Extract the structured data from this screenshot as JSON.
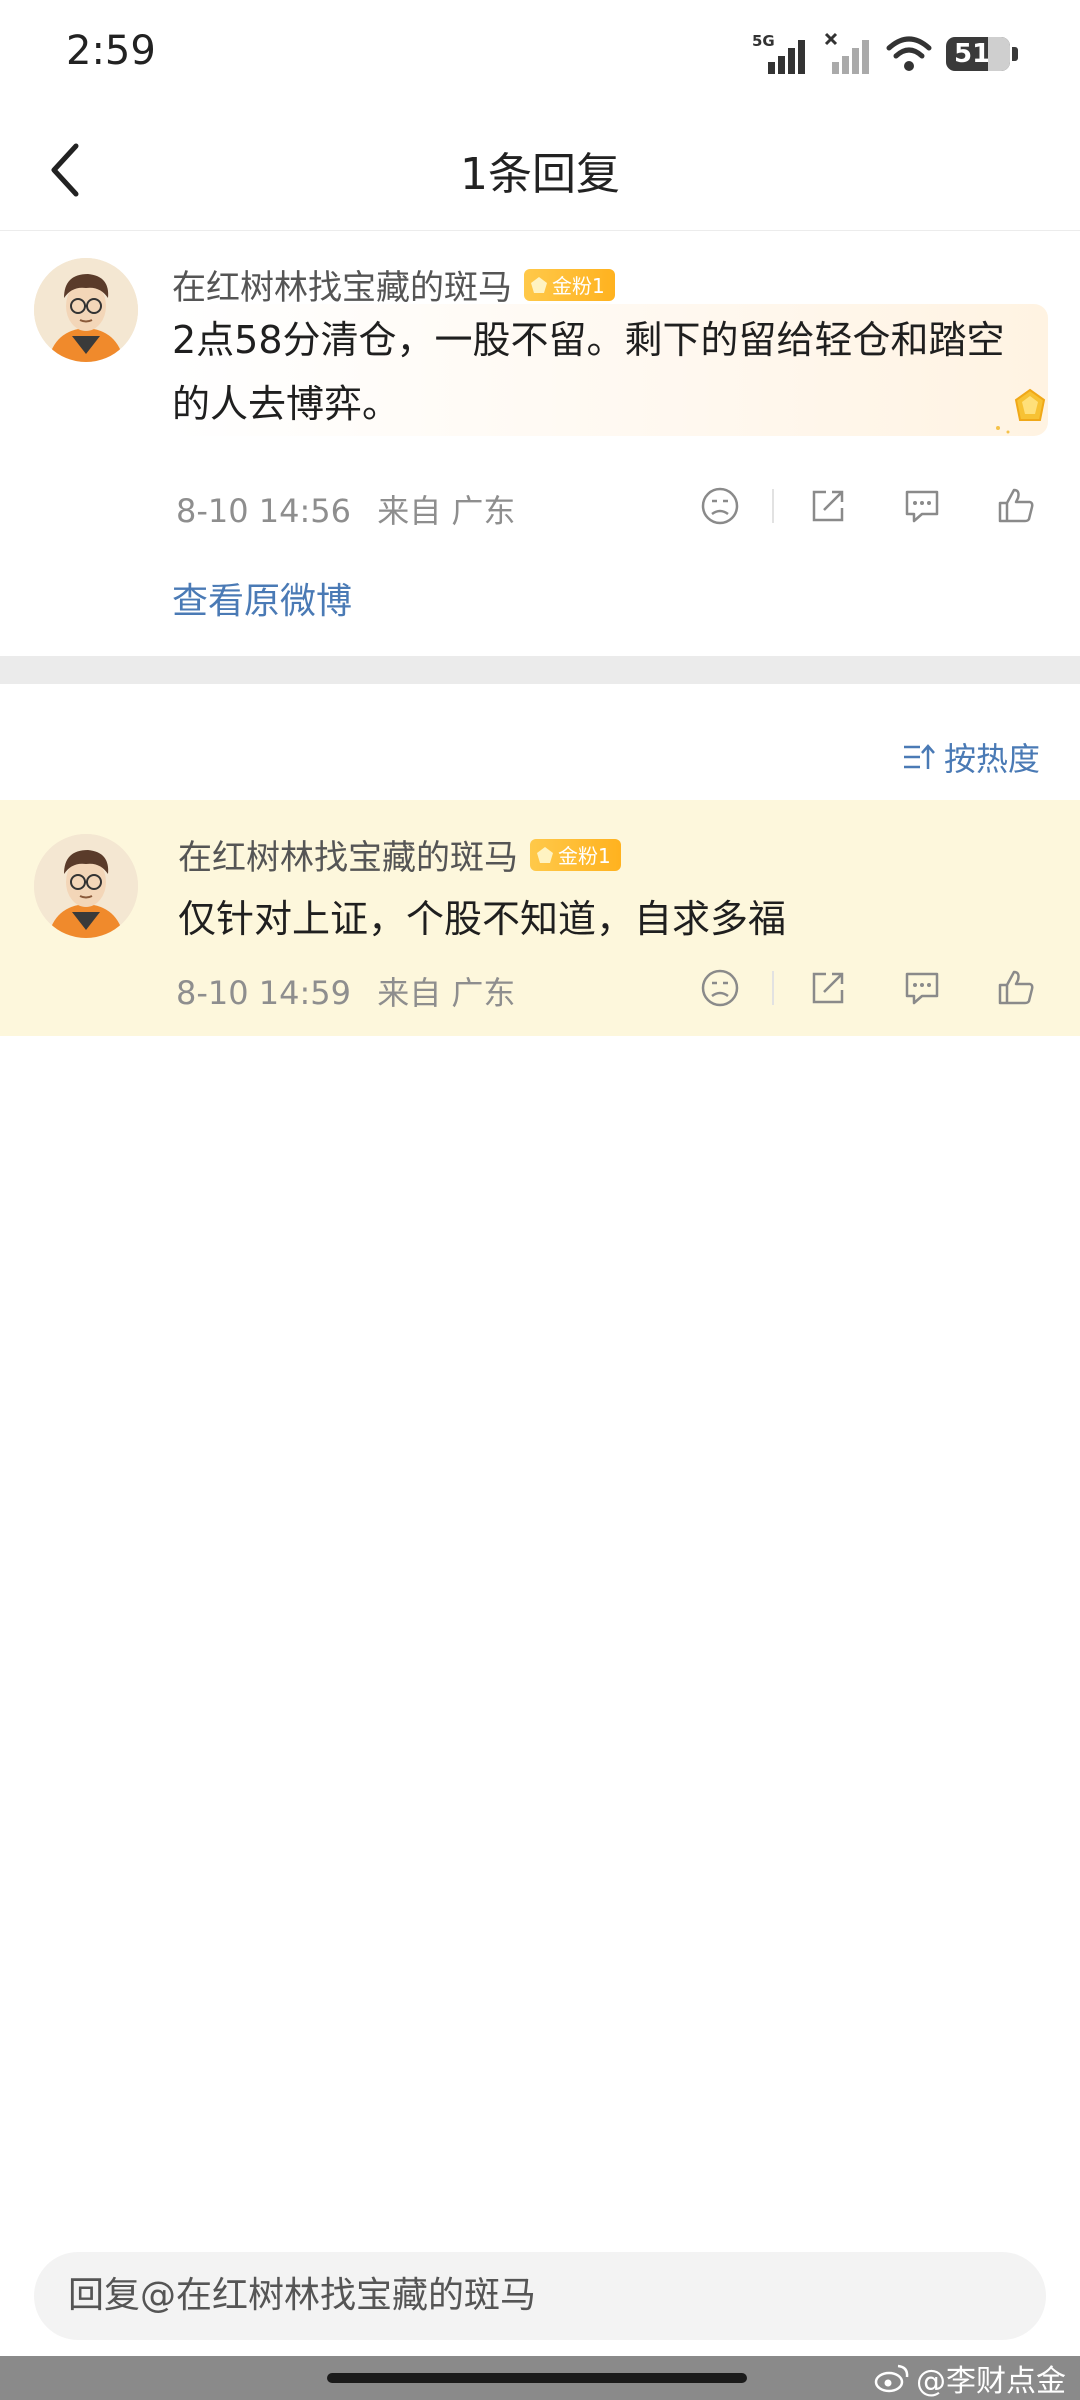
{
  "status_bar": {
    "time": "2:59",
    "network": "5G",
    "battery": "51"
  },
  "nav": {
    "title": "1条回复",
    "back_icon": "chevron-left-icon"
  },
  "original_comment": {
    "username": "在红树林找宝藏的斑马",
    "badge": "金粉1",
    "text": "2点58分清仓，一股不留。剩下的留给轻仓和踏空的人去博弈。",
    "date": "8-10 14:56",
    "source": "来自 广东",
    "view_original": "查看原微博"
  },
  "sort": {
    "label": "按热度"
  },
  "replies": [
    {
      "username": "在红树林找宝藏的斑马",
      "badge": "金粉1",
      "text": "仅针对上证，个股不知道，自求多福",
      "date": "8-10 14:59",
      "source": "来自 广东"
    }
  ],
  "reply_input": {
    "placeholder": "回复@在红树林找宝藏的斑马"
  },
  "watermark": "@李财点金",
  "colors": {
    "link": "#4a7ab5",
    "highlight_bg": "#fdf7dc",
    "badge": "#ffb21f"
  }
}
